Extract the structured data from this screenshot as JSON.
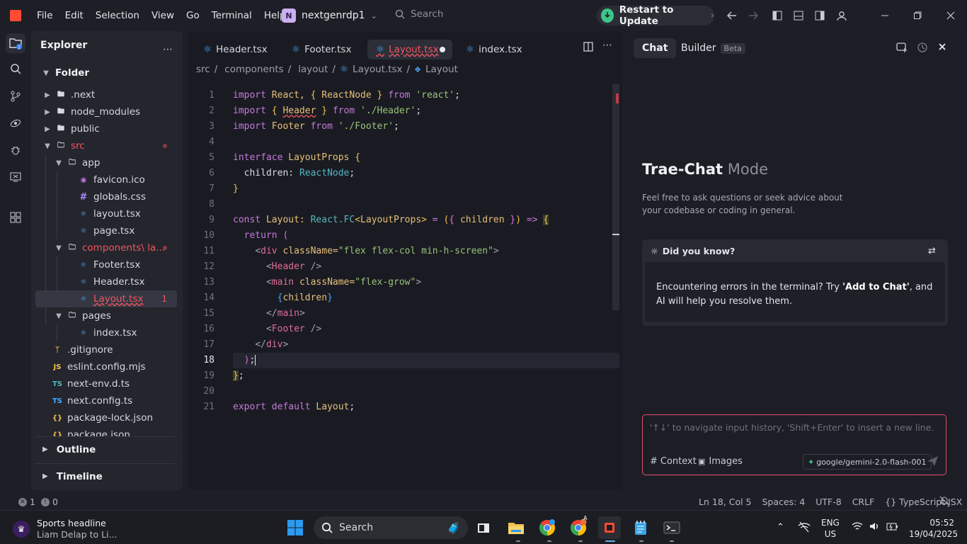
{
  "menu": [
    "File",
    "Edit",
    "Selection",
    "View",
    "Go",
    "Terminal",
    "Help"
  ],
  "project": {
    "avatar": "N",
    "name": "nextgenrdp1"
  },
  "search_label": "Search",
  "update_label": "Restart to Update",
  "explorer": {
    "title": "Explorer",
    "root": "Folder",
    "items": [
      {
        "label": ".next"
      },
      {
        "label": "node_modules"
      },
      {
        "label": "public"
      },
      {
        "label": "src"
      },
      {
        "label": "app"
      },
      {
        "label": "favicon.ico"
      },
      {
        "label": "globals.css",
        "icon": "#"
      },
      {
        "label": "layout.tsx"
      },
      {
        "label": "page.tsx"
      },
      {
        "label": "components\\ la..."
      },
      {
        "label": "Footer.tsx"
      },
      {
        "label": "Header.tsx"
      },
      {
        "label": "Layout.tsx",
        "badge": "1"
      },
      {
        "label": "pages"
      },
      {
        "label": "index.tsx"
      },
      {
        "label": ".gitignore"
      },
      {
        "label": "eslint.config.mjs",
        "icon": "JS"
      },
      {
        "label": "next-env.d.ts",
        "icon": "TS"
      },
      {
        "label": "next.config.ts",
        "icon": "TS"
      },
      {
        "label": "package-lock.json",
        "icon": "{}"
      },
      {
        "label": "package.json",
        "icon": "{}"
      }
    ],
    "outline": "Outline",
    "timeline": "Timeline"
  },
  "tabs": [
    "Header.tsx",
    "Footer.tsx",
    "Layout.tsx",
    "index.tsx"
  ],
  "breadcrumb": [
    "src",
    "components",
    "layout",
    "Layout.tsx",
    "Layout"
  ],
  "line_numbers": [
    "1",
    "2",
    "3",
    "4",
    "5",
    "6",
    "7",
    "8",
    "9",
    "10",
    "11",
    "12",
    "13",
    "14",
    "15",
    "16",
    "17",
    "18",
    "19",
    "20",
    "21"
  ],
  "code": {
    "l1": [
      "import",
      "React,",
      "{",
      "ReactNode",
      "}",
      "from",
      "'react'",
      ";"
    ],
    "l2": [
      "import",
      "{",
      "Header",
      "}",
      "from",
      "'./Header'",
      ";"
    ],
    "l3": [
      "import",
      "Footer",
      "from",
      "'./Footer'",
      ";"
    ],
    "l5": [
      "interface",
      "LayoutProps",
      "{"
    ],
    "l6": [
      "children:",
      "ReactNode",
      ";"
    ],
    "l7": [
      "}"
    ],
    "l9": [
      "const",
      "Layout:",
      "React.FC",
      "<",
      "LayoutProps",
      ">",
      "=",
      "(",
      "{",
      "children",
      "}",
      ")",
      "=>",
      "{"
    ],
    "l10": [
      "return",
      "("
    ],
    "l11": [
      "<",
      "div",
      "className=",
      "\"flex flex-col min-h-screen\"",
      ">"
    ],
    "l12": [
      "<",
      "Header",
      " />"
    ],
    "l13": [
      "<",
      "main",
      "className=",
      "\"flex-grow\"",
      ">"
    ],
    "l14": [
      "{",
      "children",
      "}"
    ],
    "l15": [
      "</",
      "main",
      ">"
    ],
    "l16": [
      "<",
      "Footer",
      " />"
    ],
    "l17": [
      "</",
      "div",
      ">"
    ],
    "l18": [
      ")",
      ";"
    ],
    "l19": [
      "}",
      ";"
    ],
    "l21": [
      "export",
      "default",
      "Layout",
      ";"
    ]
  },
  "chat": {
    "tab_chat": "Chat",
    "tab_builder": "Builder",
    "beta": "Beta",
    "mode_title": "Trae-Chat",
    "mode_suffix": "Mode",
    "intro": "Feel free to ask questions or seek advice about your codebase or coding in general.",
    "tip_title": "Did you know?",
    "tip_pre": "Encountering errors in the terminal? Try ",
    "tip_bold": "'Add to Chat'",
    "tip_post": ", and AI will help you resolve them.",
    "placeholder": "'↑↓' to navigate input history, 'Shift+Enter' to insert a new line.",
    "context": "Context",
    "images": "Images",
    "model": "google/gemini-2.0-flash-001"
  },
  "status": {
    "errors": "1",
    "warnings": "0",
    "position": "Ln 18, Col 5",
    "spaces": "Spaces: 4",
    "encoding": "UTF-8",
    "eol": "CRLF",
    "language": "TypeScript JSX"
  },
  "taskbar": {
    "news_title": "Sports headline",
    "news_sub": "Liam Delap to Li...",
    "search": "Search",
    "lang1": "ENG",
    "lang2": "US",
    "time": "05:52",
    "date": "19/04/2025",
    "chrome_badge": "A"
  },
  "colors": {
    "accent": "#ff4c33",
    "error": "#f0565f",
    "update": "#3ec48a"
  }
}
